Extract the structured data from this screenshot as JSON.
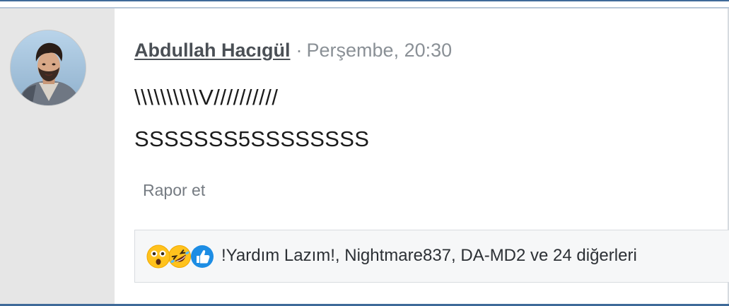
{
  "post": {
    "author": "Abdullah Hacıgül",
    "separator": "·",
    "timestamp": "Perşembe, 20:30",
    "lines": [
      "\\\\\\\\\\\\\\\\\\\\V//////////",
      "SSSSSSS5SSSSSSSS"
    ],
    "report_label": "Rapor et"
  },
  "reactions": {
    "icons": [
      "astonished-face-icon",
      "rolling-laughing-icon",
      "thumbs-up-icon"
    ],
    "summary": "!Yardım Lazım!, Nightmare837, DA-MD2 ve 24 diğerleri"
  },
  "colors": {
    "frame_border": "#3e6a99",
    "sidebar_bg": "#e6e6e6",
    "author": "#4a4f55",
    "muted": "#8a9096",
    "like_blue": "#1d8de4",
    "emoji_yellow": "#ffc21d"
  }
}
